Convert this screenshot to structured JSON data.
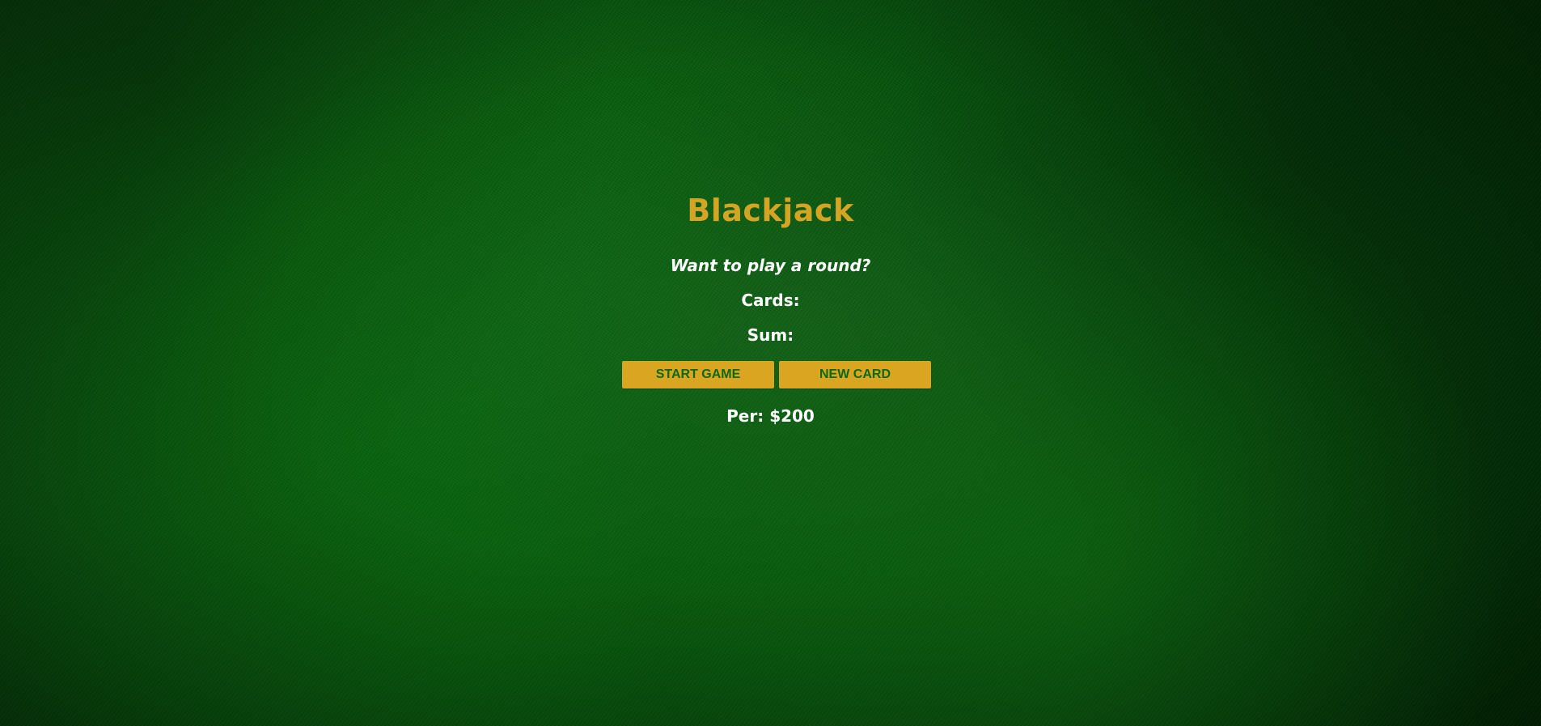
{
  "game": {
    "title": "Blackjack",
    "message": "Want to play a round?",
    "cards_label": "Cards:",
    "sum_label": "Sum:",
    "player_info": "Per: $200"
  },
  "controls": {
    "start_label": "START GAME",
    "new_card_label": "NEW CARD"
  },
  "colors": {
    "felt": "#0a5a10",
    "accent_gold": "#daa520",
    "title_gold": "#d4a524",
    "button_text": "#0a6a13",
    "text": "#ffffff"
  }
}
